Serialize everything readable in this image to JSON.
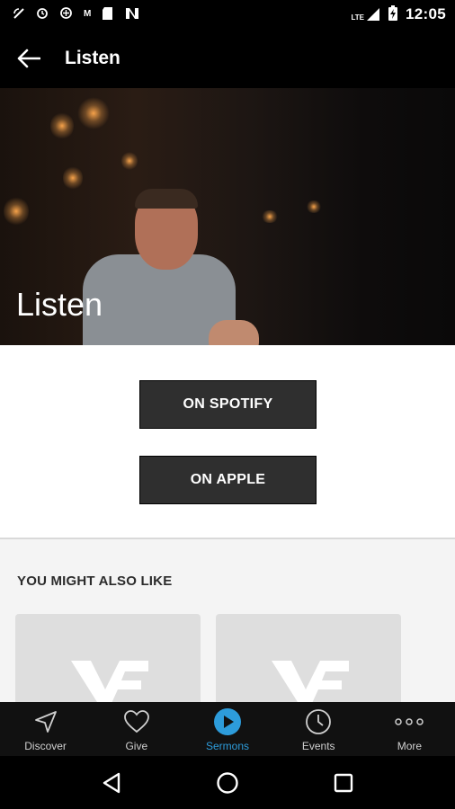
{
  "status_bar": {
    "time": "12:05",
    "left_icons": [
      "signal-notification-icon",
      "sync-icon",
      "vpn-icon",
      "gmail-icon",
      "sd-card-icon",
      "app-n-icon"
    ],
    "right_icons": [
      "lte-signal-icon",
      "battery-charging-icon"
    ],
    "network_label": "LTE",
    "mail_badge": "M"
  },
  "app_bar": {
    "back_icon": "arrow-left-icon",
    "title": "Listen"
  },
  "hero": {
    "title": "Listen"
  },
  "listen_buttons": [
    {
      "label": "ON SPOTIFY"
    },
    {
      "label": "ON APPLE"
    }
  ],
  "related": {
    "title": "YOU MIGHT ALSO LIKE",
    "cards": [
      {
        "logo": "vf-logo-icon"
      },
      {
        "logo": "vf-logo-icon"
      }
    ]
  },
  "bottom_nav": {
    "items": [
      {
        "label": "Discover",
        "icon": "navigation-arrow-icon",
        "active": false
      },
      {
        "label": "Give",
        "icon": "heart-icon",
        "active": false
      },
      {
        "label": "Sermons",
        "icon": "play-circle-icon",
        "active": true
      },
      {
        "label": "Events",
        "icon": "clock-icon",
        "active": false
      },
      {
        "label": "More",
        "icon": "more-dots-icon",
        "active": false
      }
    ],
    "active_color": "#2d9cdb",
    "inactive_color": "#cfcfcf"
  },
  "system_nav": {
    "buttons": [
      "back-triangle-icon",
      "home-circle-icon",
      "recents-square-icon"
    ]
  },
  "colors": {
    "button_bg": "#2f2f2f",
    "accent": "#2d9cdb",
    "section_bg": "#f4f4f4"
  }
}
